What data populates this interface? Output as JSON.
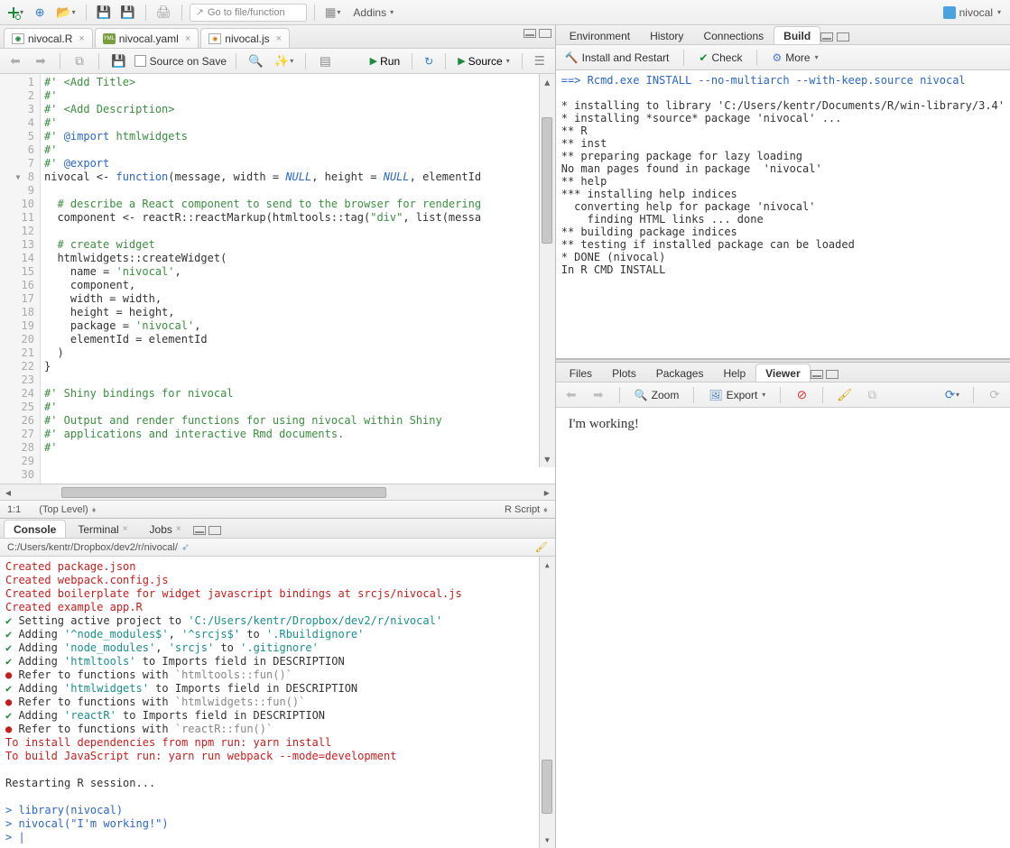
{
  "toolbar": {
    "goto_placeholder": "Go to file/function",
    "addins_label": "Addins"
  },
  "project": {
    "name": "nivocal"
  },
  "file_tabs": [
    {
      "name": "nivocal.R",
      "type": "r"
    },
    {
      "name": "nivocal.yaml",
      "type": "yaml"
    },
    {
      "name": "nivocal.js",
      "type": "js"
    }
  ],
  "source_toolbar": {
    "source_on_save": "Source on Save",
    "run": "Run",
    "source": "Source"
  },
  "editor": {
    "lines": [
      {
        "n": 1,
        "html": "<span class='c-comment'>#' &lt;Add Title&gt;</span>"
      },
      {
        "n": 2,
        "html": "<span class='c-comment'>#'</span>"
      },
      {
        "n": 3,
        "html": "<span class='c-comment'>#' &lt;Add Description&gt;</span>"
      },
      {
        "n": 4,
        "html": "<span class='c-comment'>#'</span>"
      },
      {
        "n": 5,
        "html": "<span class='c-comment'>#' </span><span class='c-blue'>@import</span><span class='c-comment'> htmlwidgets</span>"
      },
      {
        "n": 6,
        "html": "<span class='c-comment'>#'</span>"
      },
      {
        "n": 7,
        "html": "<span class='c-comment'>#' </span><span class='c-blue'>@export</span>"
      },
      {
        "n": 8,
        "fold": true,
        "html": "nivocal &lt;- <span class='c-blue'>function</span>(message, width = <span class='c-null'>NULL</span>, height = <span class='c-null'>NULL</span>, elementId"
      },
      {
        "n": 9,
        "html": ""
      },
      {
        "n": 10,
        "html": "  <span class='c-comment'># describe a React component to send to the browser for rendering</span>"
      },
      {
        "n": 11,
        "html": "  component &lt;- reactR::reactMarkup(htmltools::tag(<span class='c-str'>\"div\"</span>, list(messa"
      },
      {
        "n": 12,
        "html": ""
      },
      {
        "n": 13,
        "html": "  <span class='c-comment'># create widget</span>"
      },
      {
        "n": 14,
        "html": "  htmlwidgets::createWidget("
      },
      {
        "n": 15,
        "html": "    name = <span class='c-str'>'nivocal'</span>,"
      },
      {
        "n": 16,
        "html": "    component,"
      },
      {
        "n": 17,
        "html": "    width = width,"
      },
      {
        "n": 18,
        "html": "    height = height,"
      },
      {
        "n": 19,
        "html": "    package = <span class='c-str'>'nivocal'</span>,"
      },
      {
        "n": 20,
        "html": "    elementId = elementId"
      },
      {
        "n": 21,
        "html": "  )"
      },
      {
        "n": 22,
        "html": "}"
      },
      {
        "n": 23,
        "html": ""
      },
      {
        "n": 24,
        "html": "<span class='c-comment'>#' Shiny bindings for nivocal</span>"
      },
      {
        "n": 25,
        "html": "<span class='c-comment'>#'</span>"
      },
      {
        "n": 26,
        "html": "<span class='c-comment'>#' Output and render functions for using nivocal within Shiny</span>"
      },
      {
        "n": 27,
        "html": "<span class='c-comment'>#' applications and interactive Rmd documents.</span>"
      },
      {
        "n": 28,
        "html": "<span class='c-comment'>#'</span>"
      },
      {
        "n": 29,
        "html": ""
      },
      {
        "n": 30,
        "html": ""
      }
    ],
    "status_pos": "1:1",
    "status_scope": "(Top Level)",
    "status_type": "R Script"
  },
  "console": {
    "tabs": [
      "Console",
      "Terminal",
      "Jobs"
    ],
    "path": "C:/Users/kentr/Dropbox/dev2/r/nivocal/",
    "lines": [
      {
        "cls": "red",
        "t": "Created package.json"
      },
      {
        "cls": "red",
        "t": "Created webpack.config.js"
      },
      {
        "cls": "red",
        "t": "Created boilerplate for widget javascript bindings at srcjs/nivocal.js"
      },
      {
        "cls": "red",
        "t": "Created example app.R"
      },
      {
        "cls": "",
        "pre": "✔ ",
        "precls": "green",
        "rest": "Setting active project to <span class='teal'>'C:/Users/kentr/Dropbox/dev2/r/nivocal'</span>"
      },
      {
        "cls": "",
        "pre": "✔ ",
        "precls": "green",
        "rest": "Adding <span class='teal'>'^node_modules$'</span>, <span class='teal'>'^srcjs$'</span> to <span class='teal'>'.Rbuildignore'</span>"
      },
      {
        "cls": "",
        "pre": "✔ ",
        "precls": "green",
        "rest": "Adding <span class='teal'>'node_modules'</span>, <span class='teal'>'srcjs'</span> to <span class='teal'>'.gitignore'</span>"
      },
      {
        "cls": "",
        "pre": "✔ ",
        "precls": "green",
        "rest": "Adding <span class='teal'>'htmltools'</span> to Imports field in DESCRIPTION"
      },
      {
        "cls": "",
        "pre": "● ",
        "precls": "red",
        "rest": "Refer to functions with <span class='grey'>`htmltools::fun()`</span>"
      },
      {
        "cls": "",
        "pre": "✔ ",
        "precls": "green",
        "rest": "Adding <span class='teal'>'htmlwidgets'</span> to Imports field in DESCRIPTION"
      },
      {
        "cls": "",
        "pre": "● ",
        "precls": "red",
        "rest": "Refer to functions with <span class='grey'>`htmlwidgets::fun()`</span>"
      },
      {
        "cls": "",
        "pre": "✔ ",
        "precls": "green",
        "rest": "Adding <span class='teal'>'reactR'</span> to Imports field in DESCRIPTION"
      },
      {
        "cls": "",
        "pre": "● ",
        "precls": "red",
        "rest": "Refer to functions with <span class='grey'>`reactR::fun()`</span>"
      },
      {
        "cls": "red",
        "t": "To install dependencies from npm run: yarn install"
      },
      {
        "cls": "red",
        "t": "To build JavaScript run: yarn run webpack --mode=development"
      },
      {
        "cls": "",
        "t": ""
      },
      {
        "cls": "",
        "t": "Restarting R session..."
      },
      {
        "cls": "",
        "t": ""
      },
      {
        "cls": "blue",
        "t": "> library(nivocal)"
      },
      {
        "cls": "blue",
        "t": "> nivocal(\"I'm working!\")"
      },
      {
        "cls": "blue",
        "t": "> |"
      }
    ]
  },
  "right_top": {
    "tabs": [
      "Environment",
      "History",
      "Connections",
      "Build"
    ],
    "toolbar": {
      "install": "Install and Restart",
      "check": "Check",
      "more": "More"
    },
    "output": [
      {
        "cls": "blue",
        "t": "==> Rcmd.exe INSTALL --no-multiarch --with-keep.source nivocal"
      },
      {
        "cls": "",
        "t": ""
      },
      {
        "cls": "",
        "t": "* installing to library 'C:/Users/kentr/Documents/R/win-library/3.4'"
      },
      {
        "cls": "",
        "t": "* installing *source* package 'nivocal' ..."
      },
      {
        "cls": "",
        "t": "** R"
      },
      {
        "cls": "",
        "t": "** inst"
      },
      {
        "cls": "",
        "t": "** preparing package for lazy loading"
      },
      {
        "cls": "",
        "t": "No man pages found in package  'nivocal' "
      },
      {
        "cls": "",
        "t": "** help"
      },
      {
        "cls": "",
        "t": "*** installing help indices"
      },
      {
        "cls": "",
        "t": "  converting help for package 'nivocal'"
      },
      {
        "cls": "",
        "t": "    finding HTML links ... done"
      },
      {
        "cls": "",
        "t": "** building package indices"
      },
      {
        "cls": "",
        "t": "** testing if installed package can be loaded"
      },
      {
        "cls": "",
        "t": "* DONE (nivocal)"
      },
      {
        "cls": "",
        "t": "In R CMD INSTALL"
      }
    ]
  },
  "right_bottom": {
    "tabs": [
      "Files",
      "Plots",
      "Packages",
      "Help",
      "Viewer"
    ],
    "toolbar": {
      "zoom": "Zoom",
      "export": "Export"
    },
    "viewer_text": "I'm working!"
  }
}
